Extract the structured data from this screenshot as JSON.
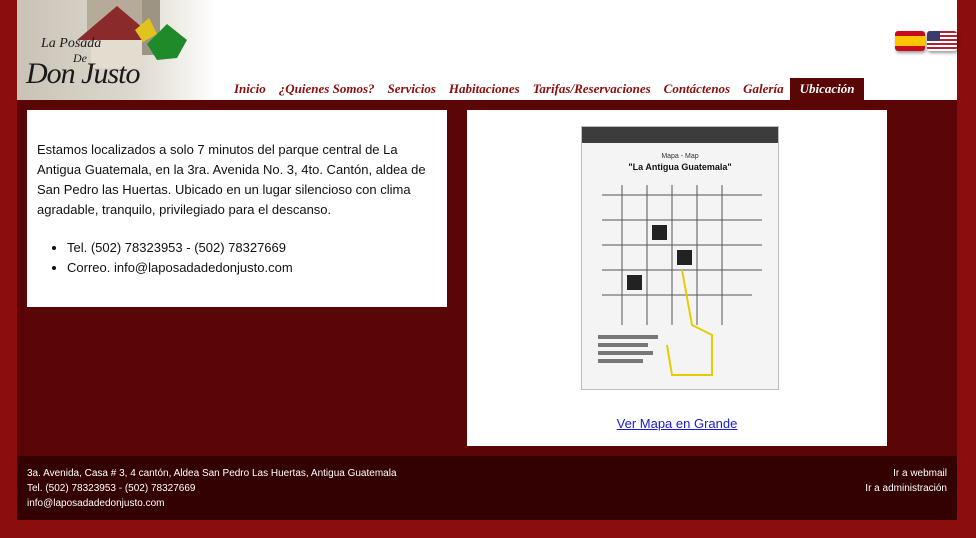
{
  "logo": {
    "line1": "La Posada",
    "line2": "De",
    "line3": "Don Justo"
  },
  "flags": [
    "spanish-flag-icon",
    "us-flag-icon"
  ],
  "nav": {
    "items": [
      {
        "label": "Inicio"
      },
      {
        "label": "¿Quienes Somos?"
      },
      {
        "label": "Servicios"
      },
      {
        "label": "Habitaciones"
      },
      {
        "label": "Tarifas/Reservaciones"
      },
      {
        "label": "Contáctenos"
      },
      {
        "label": "Galería"
      },
      {
        "label": "Ubicación",
        "active": true
      }
    ]
  },
  "location": {
    "intro": "Estamos localizados a solo 7 minutos del parque central de La Antigua Guatemala, en la 3ra. Avenida No. 3, 4to. Cantón, aldea de San Pedro las Huertas. Ubicado en un lugar silencioso con clima agradable, tranquilo, privilegiado para el descanso.",
    "phone": "Tel. (502) 78323953 - (502) 78327669",
    "email": "Correo. info@laposadadedonjusto.com"
  },
  "map": {
    "subtitle": "Mapa - Map",
    "title": "\"La Antigua Guatemala\"",
    "link_label": "Ver Mapa en Grande"
  },
  "footer": {
    "address": "3a. Avenida, Casa # 3, 4 cantón, Aldea San Pedro Las Huertas, Antigua Guatemala",
    "phone": "Tel. (502) 78323953 - (502) 78327669",
    "email": "info@laposadadedonjusto.com",
    "webmail_label": "Ir a webmail",
    "admin_label": "Ir a administración"
  },
  "colors": {
    "brand": "#8b0d0d",
    "panel": "#5a0606",
    "footer": "#330101"
  }
}
